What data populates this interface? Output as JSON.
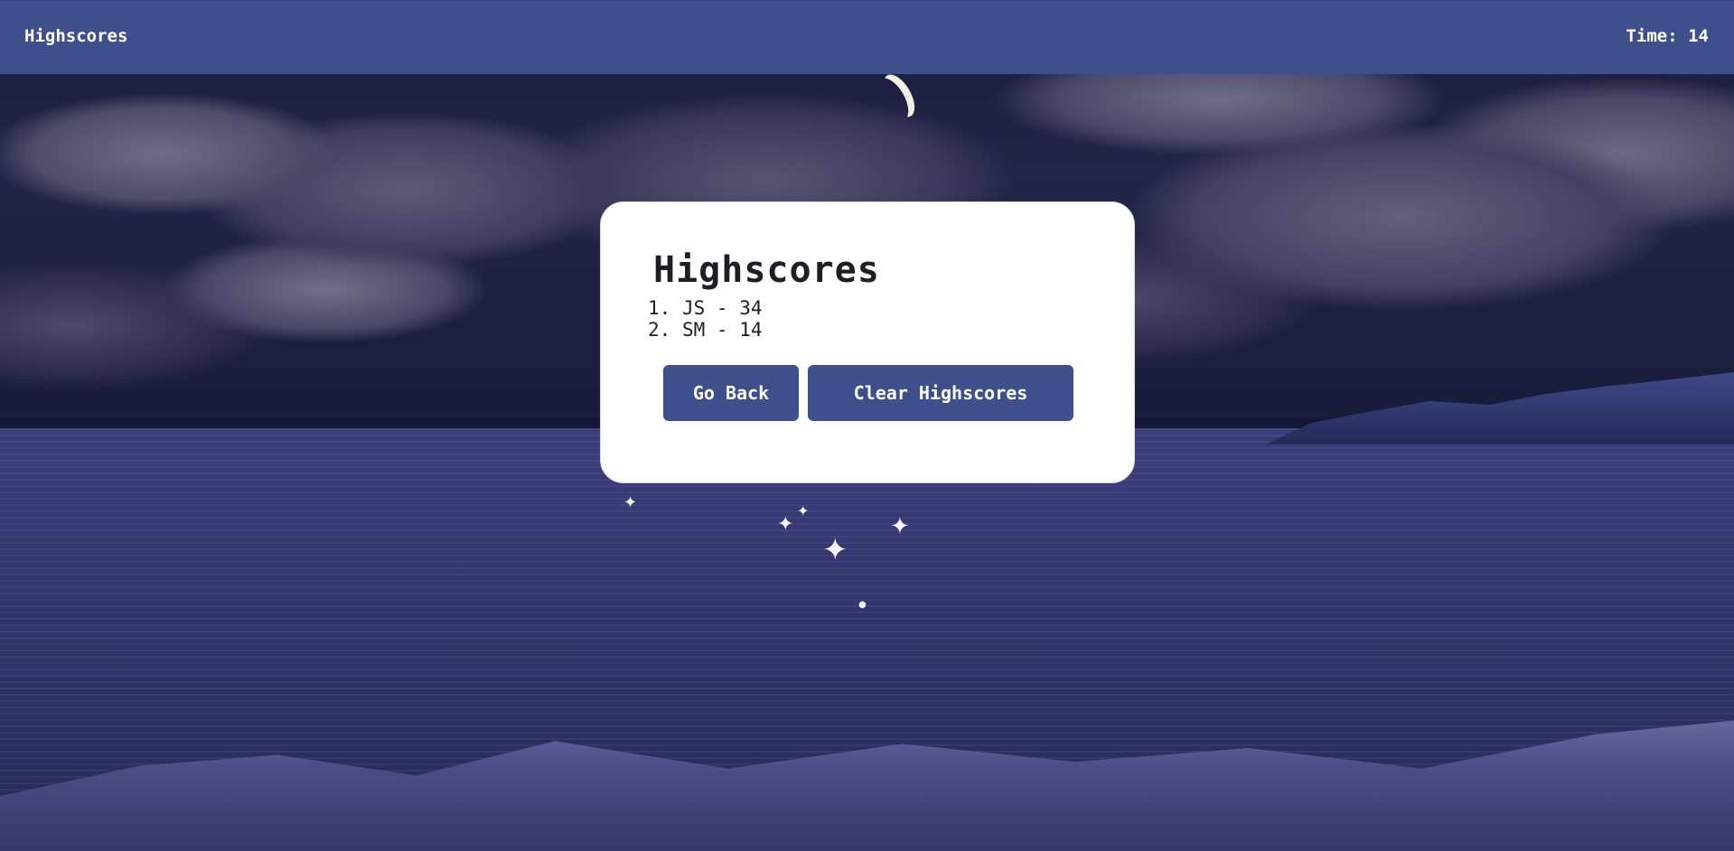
{
  "header": {
    "link_label": "Highscores",
    "timer_label": "Time:",
    "timer_value": "14"
  },
  "card": {
    "title": "Highscores",
    "scores": [
      {
        "rank": "1.",
        "initials": "JS",
        "score": "34"
      },
      {
        "rank": "2.",
        "initials": "SM",
        "score": "14"
      }
    ],
    "go_back_label": "Go Back",
    "clear_label": "Clear Highscores"
  },
  "colors": {
    "accent": "#3f4f8b",
    "card_background": "#ffffff",
    "text": "#1e1e24"
  },
  "background": {
    "description_icon": "pixel-night-sea-scene"
  }
}
